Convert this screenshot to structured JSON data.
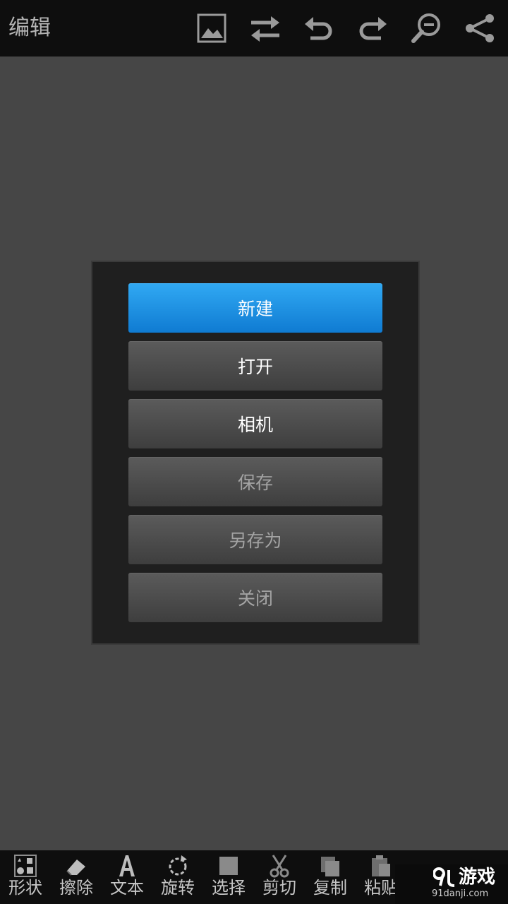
{
  "topbar": {
    "title": "编辑",
    "icons": [
      "image-icon",
      "swap-icon",
      "undo-icon",
      "redo-icon",
      "zoom-icon",
      "share-icon"
    ]
  },
  "dialog": {
    "buttons": [
      {
        "label": "新建",
        "state": "selected"
      },
      {
        "label": "打开",
        "state": "enabled"
      },
      {
        "label": "相机",
        "state": "enabled"
      },
      {
        "label": "保存",
        "state": "disabled"
      },
      {
        "label": "另存为",
        "state": "disabled"
      },
      {
        "label": "关闭",
        "state": "disabled"
      }
    ]
  },
  "toolbar": {
    "items": [
      {
        "label": "形状",
        "icon": "shapes-icon"
      },
      {
        "label": "擦除",
        "icon": "eraser-icon"
      },
      {
        "label": "文本",
        "icon": "text-icon"
      },
      {
        "label": "旋转",
        "icon": "rotate-icon"
      },
      {
        "label": "选择",
        "icon": "select-icon"
      },
      {
        "label": "剪切",
        "icon": "scissors-icon"
      },
      {
        "label": "复制",
        "icon": "copy-icon"
      },
      {
        "label": "粘贴",
        "icon": "paste-icon"
      }
    ]
  },
  "watermark": {
    "brand": "游戏",
    "site": "91danji.com"
  },
  "colors": {
    "accent": "#1a8fe3",
    "bar": "#0e0e0e",
    "canvas": "#464646",
    "dialog": "#1f1f1f"
  }
}
